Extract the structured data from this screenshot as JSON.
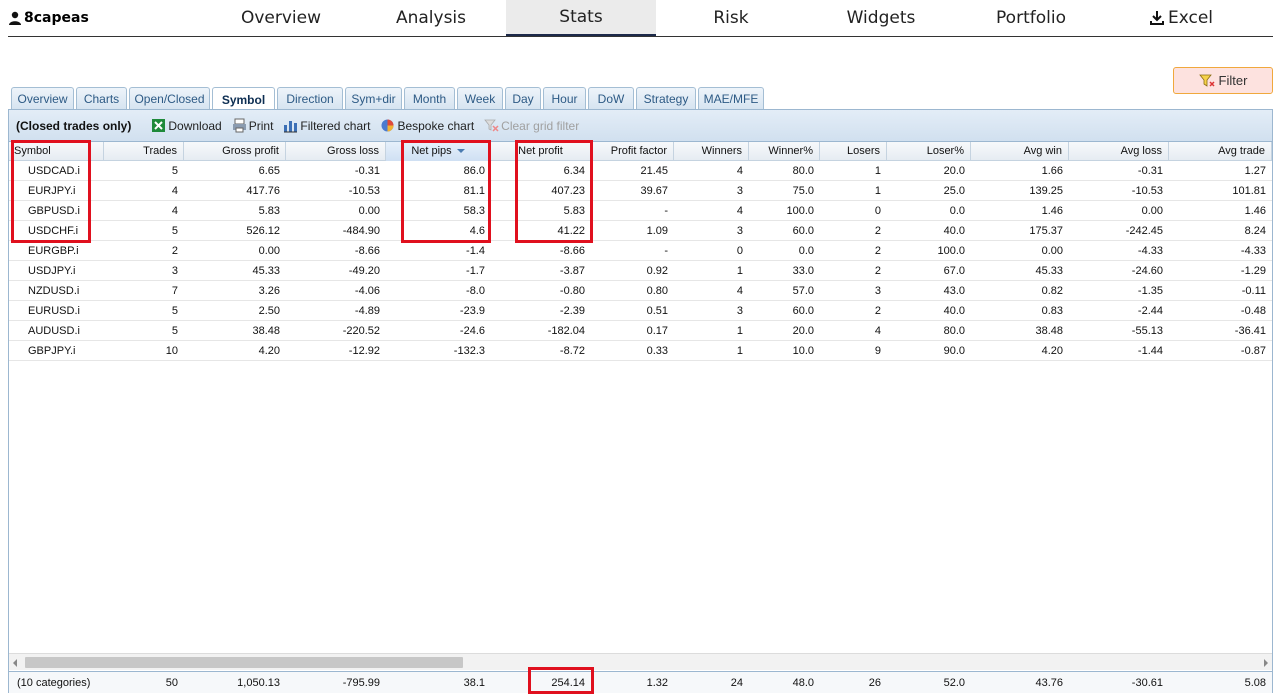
{
  "user": {
    "name": "8capeas"
  },
  "nav": {
    "tabs": [
      {
        "label": "Overview"
      },
      {
        "label": "Analysis"
      },
      {
        "label": "Stats"
      },
      {
        "label": "Risk"
      },
      {
        "label": "Widgets"
      },
      {
        "label": "Portfolio"
      },
      {
        "label": "Excel"
      }
    ],
    "active": "Stats"
  },
  "filter_button": {
    "label": "Filter"
  },
  "subtabs": {
    "items": [
      "Overview",
      "Charts",
      "Open/Closed",
      "Symbol",
      "Direction",
      "Sym+dir",
      "Month",
      "Week",
      "Day",
      "Hour",
      "DoW",
      "Strategy",
      "MAE/MFE"
    ],
    "active": "Symbol"
  },
  "toolbar": {
    "label": "(Closed trades only)",
    "download": "Download",
    "print": "Print",
    "filtered_chart": "Filtered chart",
    "bespoke_chart": "Bespoke chart",
    "clear_grid_filter": "Clear grid filter"
  },
  "grid": {
    "columns": [
      "Symbol",
      "Trades",
      "Gross profit",
      "Gross loss",
      "Net pips",
      "Net profit",
      "Profit factor",
      "Winners",
      "Winner%",
      "Losers",
      "Loser%",
      "Avg win",
      "Avg loss",
      "Avg trade"
    ],
    "sorted_column": "Net pips",
    "rows": [
      [
        "USDCAD.i",
        "5",
        "6.65",
        "-0.31",
        "86.0",
        "6.34",
        "21.45",
        "4",
        "80.0",
        "1",
        "20.0",
        "1.66",
        "-0.31",
        "1.27"
      ],
      [
        "EURJPY.i",
        "4",
        "417.76",
        "-10.53",
        "81.1",
        "407.23",
        "39.67",
        "3",
        "75.0",
        "1",
        "25.0",
        "139.25",
        "-10.53",
        "101.81"
      ],
      [
        "GBPUSD.i",
        "4",
        "5.83",
        "0.00",
        "58.3",
        "5.83",
        "-",
        "4",
        "100.0",
        "0",
        "0.0",
        "1.46",
        "0.00",
        "1.46"
      ],
      [
        "USDCHF.i",
        "5",
        "526.12",
        "-484.90",
        "4.6",
        "41.22",
        "1.09",
        "3",
        "60.0",
        "2",
        "40.0",
        "175.37",
        "-242.45",
        "8.24"
      ],
      [
        "EURGBP.i",
        "2",
        "0.00",
        "-8.66",
        "-1.4",
        "-8.66",
        "-",
        "0",
        "0.0",
        "2",
        "100.0",
        "0.00",
        "-4.33",
        "-4.33"
      ],
      [
        "USDJPY.i",
        "3",
        "45.33",
        "-49.20",
        "-1.7",
        "-3.87",
        "0.92",
        "1",
        "33.0",
        "2",
        "67.0",
        "45.33",
        "-24.60",
        "-1.29"
      ],
      [
        "NZDUSD.i",
        "7",
        "3.26",
        "-4.06",
        "-8.0",
        "-0.80",
        "0.80",
        "4",
        "57.0",
        "3",
        "43.0",
        "0.82",
        "-1.35",
        "-0.11"
      ],
      [
        "EURUSD.i",
        "5",
        "2.50",
        "-4.89",
        "-23.9",
        "-2.39",
        "0.51",
        "3",
        "60.0",
        "2",
        "40.0",
        "0.83",
        "-2.44",
        "-0.48"
      ],
      [
        "AUDUSD.i",
        "5",
        "38.48",
        "-220.52",
        "-24.6",
        "-182.04",
        "0.17",
        "1",
        "20.0",
        "4",
        "80.0",
        "38.48",
        "-55.13",
        "-36.41"
      ],
      [
        "GBPJPY.i",
        "10",
        "4.20",
        "-12.92",
        "-132.3",
        "-8.72",
        "0.33",
        "1",
        "10.0",
        "9",
        "90.0",
        "4.20",
        "-1.44",
        "-0.87"
      ]
    ],
    "footer": [
      "(10 categories)",
      "50",
      "1,050.13",
      "-795.99",
      "38.1",
      "254.14",
      "1.32",
      "24",
      "48.0",
      "26",
      "52.0",
      "43.76",
      "-30.61",
      "5.08"
    ]
  },
  "colors": {
    "highlight": "#e0101e",
    "filter_bg": "#fde2df",
    "filter_border": "#f0a83d",
    "tab_border": "#a4bed4",
    "toolbar_bg": "#d1e0ef"
  }
}
